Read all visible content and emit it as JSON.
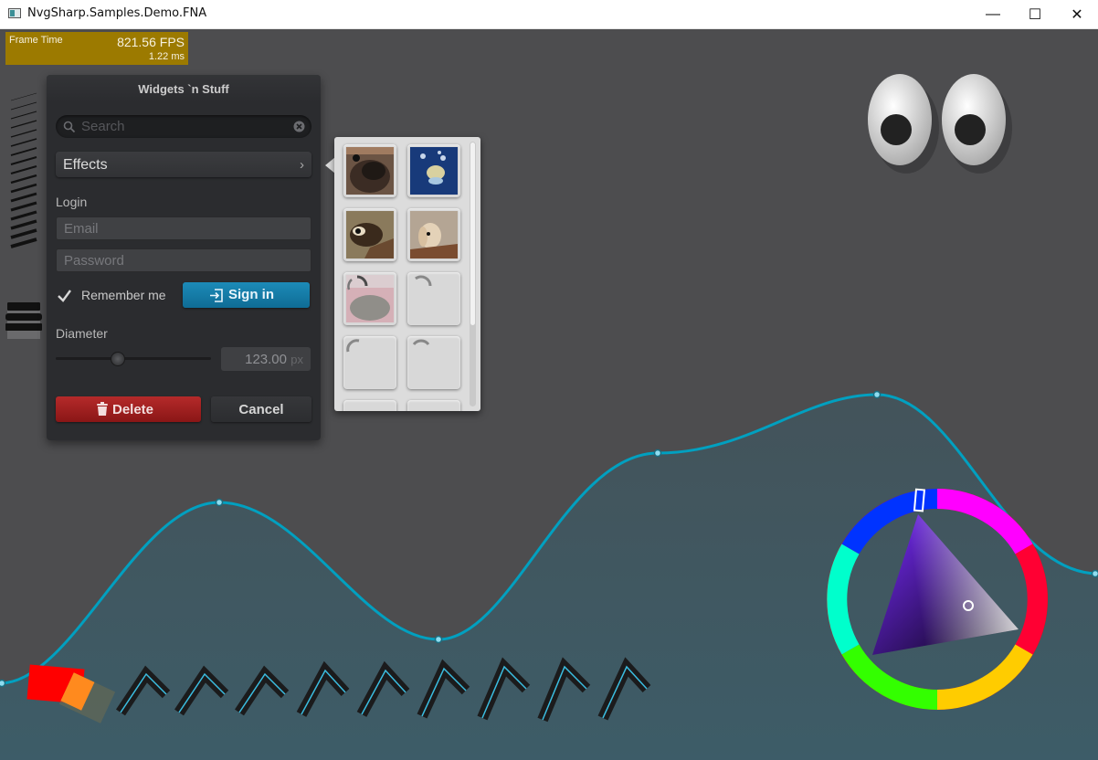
{
  "window": {
    "title": "NvgSharp.Samples.Demo.FNA",
    "minimize_glyph": "—",
    "maximize_glyph": "☐",
    "close_glyph": "✕"
  },
  "fps_graph": {
    "label": "Frame Time",
    "fps": "821.56 FPS",
    "ms": "1.22 ms"
  },
  "panel": {
    "title": "Widgets `n Stuff",
    "search_placeholder": "Search",
    "effects_label": "Effects",
    "login_label": "Login",
    "email_placeholder": "Email",
    "password_placeholder": "Password",
    "remember_label": "Remember me",
    "remember_checked": true,
    "signin_label": "Sign in",
    "diameter_label": "Diameter",
    "slider_fraction": 0.4,
    "diameter_value": "123.00",
    "diameter_unit": "px",
    "delete_label": "Delete",
    "cancel_label": "Cancel"
  },
  "thumbnails": {
    "images": [
      "dog-nose",
      "jellyfish",
      "squirrel-monkey",
      "bunny",
      "cat-loading",
      "loading",
      "loading",
      "loading"
    ]
  },
  "colors": {
    "background": "#4d4d4f",
    "panel": "#2b2c2f",
    "accent_blue": "#1c8bb8",
    "danger_red": "#b52a2a",
    "fps_bar": "#9c7a00",
    "graph_line": "#00a0c0"
  }
}
